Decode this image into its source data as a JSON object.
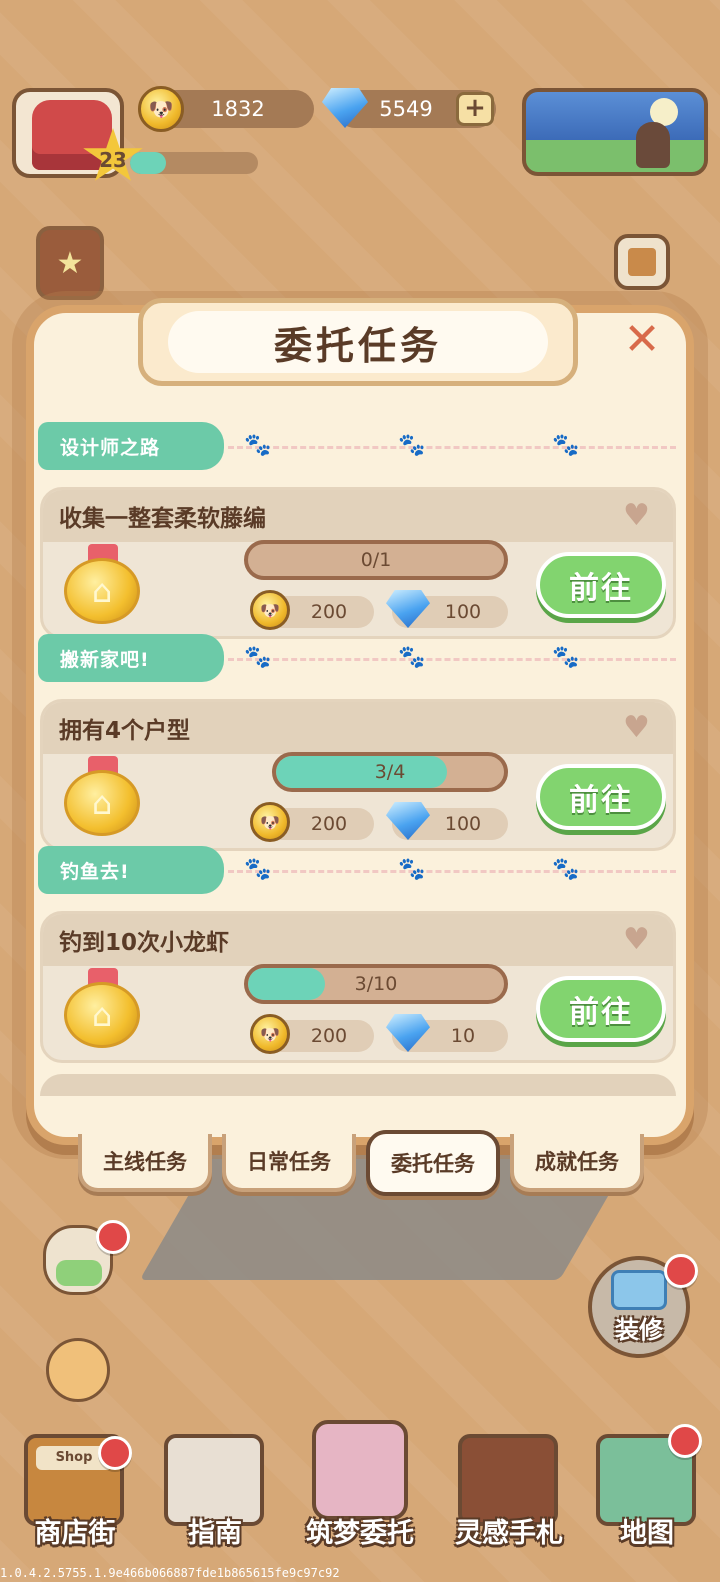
{
  "hud": {
    "level": "23",
    "xp_progress": 0.28,
    "coins": "1832",
    "gems": "5549",
    "plus": "+"
  },
  "modal": {
    "title": "委托任务",
    "close": "✕",
    "sections": [
      {
        "tag": "设计师之路",
        "task": {
          "title": "收集一整套柔软藤编",
          "progress_text": "0/1",
          "progress": 0.0,
          "coin_reward": "200",
          "gem_reward": "100",
          "button": "前往"
        }
      },
      {
        "tag": "搬新家吧!",
        "task": {
          "title": "拥有4个户型",
          "progress_text": "3/4",
          "progress": 0.75,
          "coin_reward": "200",
          "gem_reward": "100",
          "button": "前往"
        }
      },
      {
        "tag": "钓鱼去!",
        "task": {
          "title": "钓到10次小龙虾",
          "progress_text": "3/10",
          "progress": 0.3,
          "coin_reward": "200",
          "gem_reward": "10",
          "button": "前往"
        }
      }
    ]
  },
  "tabs": [
    "主线任务",
    "日常任务",
    "委托任务",
    "成就任务"
  ],
  "active_tab": "委托任务",
  "side": {
    "renovate": "装修"
  },
  "bottom_nav": [
    "商店街",
    "指南",
    "筑梦委托",
    "灵感手札",
    "地图"
  ],
  "shop_sign": "Shop",
  "version": "1.0.4.2.5755.1.9e466b066887fde1b865615fe9c97c92",
  "colors": {
    "background": "#d6a877",
    "accent_green": "#82d46f",
    "progress_teal": "#6dd3b8",
    "tag_teal": "#6ccaa8",
    "badge_red": "#e04848"
  }
}
